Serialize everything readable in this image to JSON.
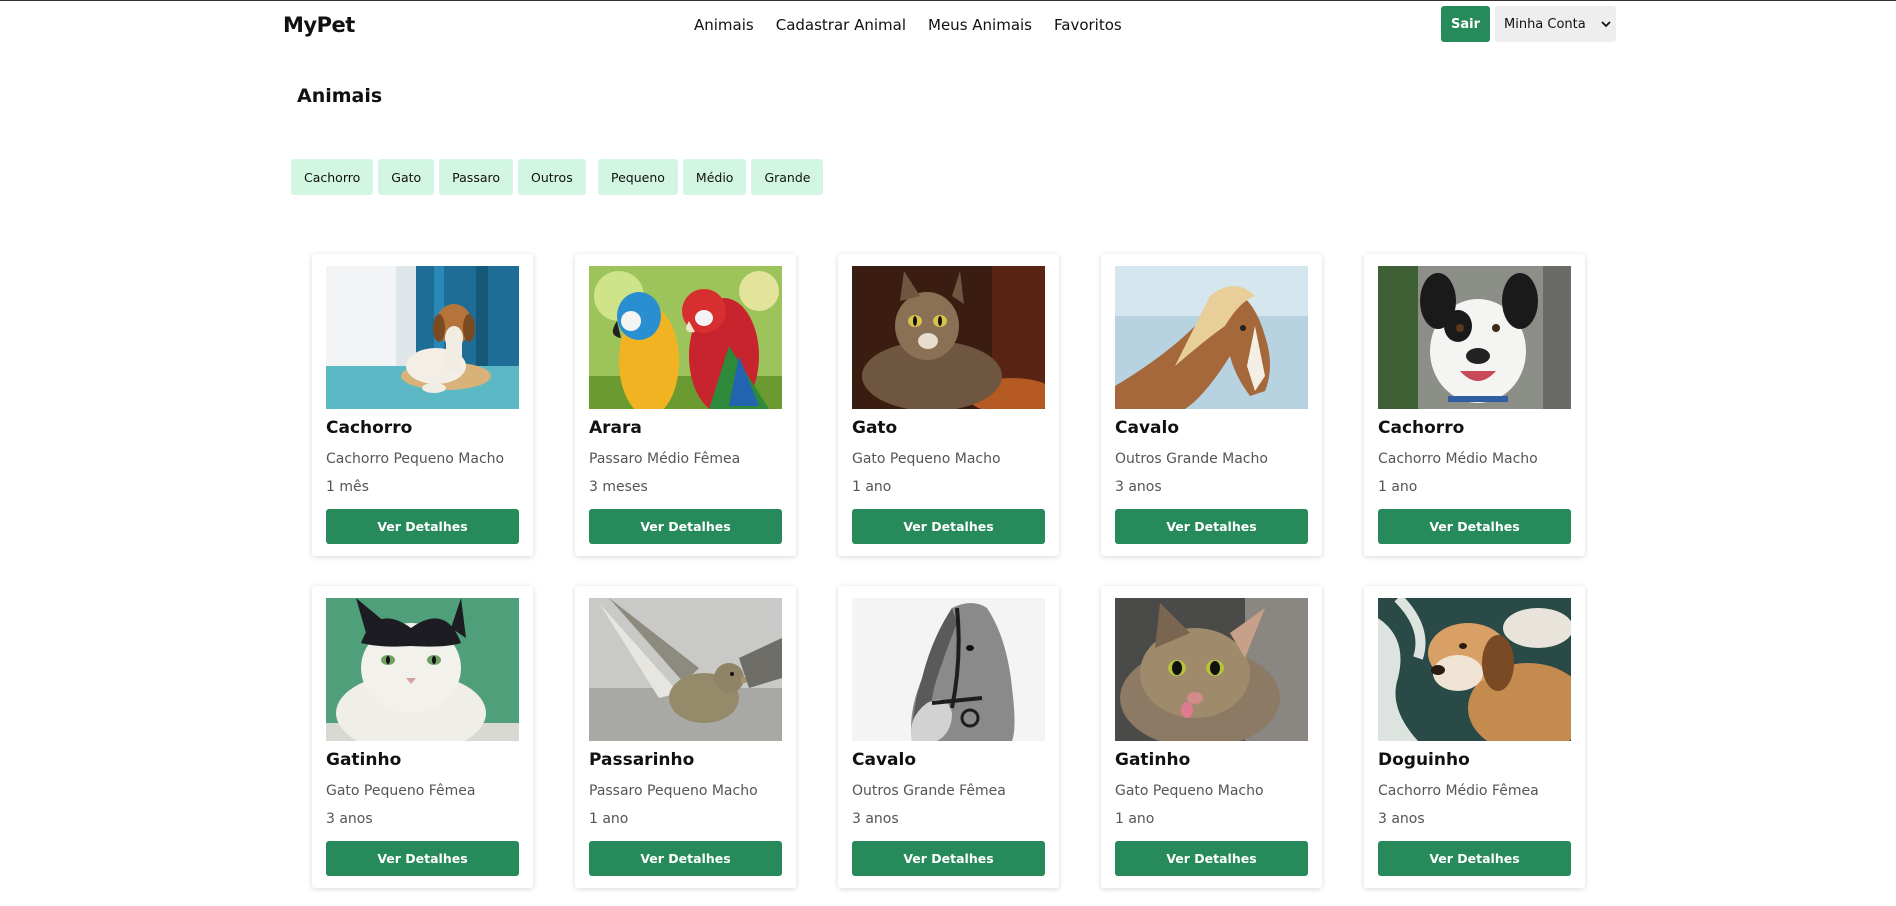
{
  "header": {
    "logo": "MyPet",
    "nav": [
      "Animais",
      "Cadastrar Animal",
      "Meus Animais",
      "Favoritos"
    ],
    "logout_label": "Sair",
    "account_label": "Minha Conta"
  },
  "page_title": "Animais",
  "filters": {
    "species": [
      "Cachorro",
      "Gato",
      "Passaro",
      "Outros"
    ],
    "sizes": [
      "Pequeno",
      "Médio",
      "Grande"
    ]
  },
  "button_label": "Ver Detalhes",
  "animals": [
    {
      "name": "Cachorro",
      "desc": "Cachorro Pequeno Macho",
      "age": "1 mês",
      "photo": "dog-beagle"
    },
    {
      "name": "Arara",
      "desc": "Passaro Médio Fêmea",
      "age": "3 meses",
      "photo": "parrots"
    },
    {
      "name": "Gato",
      "desc": "Gato Pequeno Macho",
      "age": "1 ano",
      "photo": "tabby-cat"
    },
    {
      "name": "Cavalo",
      "desc": "Outros Grande Macho",
      "age": "3 anos",
      "photo": "horse-brown"
    },
    {
      "name": "Cachorro",
      "desc": "Cachorro Médio Macho",
      "age": "1 ano",
      "photo": "dog-spotted"
    },
    {
      "name": "Gatinho",
      "desc": "Gato Pequeno Fêmea",
      "age": "3 anos",
      "photo": "black-white-cat"
    },
    {
      "name": "Passarinho",
      "desc": "Passaro Pequeno Macho",
      "age": "1 ano",
      "photo": "small-bird"
    },
    {
      "name": "Cavalo",
      "desc": "Outros Grande Fêmea",
      "age": "3 anos",
      "photo": "horse-grey"
    },
    {
      "name": "Gatinho",
      "desc": "Gato Pequeno Macho",
      "age": "1 ano",
      "photo": "tabby-kitten"
    },
    {
      "name": "Doguinho",
      "desc": "Cachorro Médio Fêmea",
      "age": "3 anos",
      "photo": "dog-sleepy"
    }
  ],
  "colors": {
    "accent": "#268a5a",
    "chip_bg": "#d2f6e2"
  }
}
